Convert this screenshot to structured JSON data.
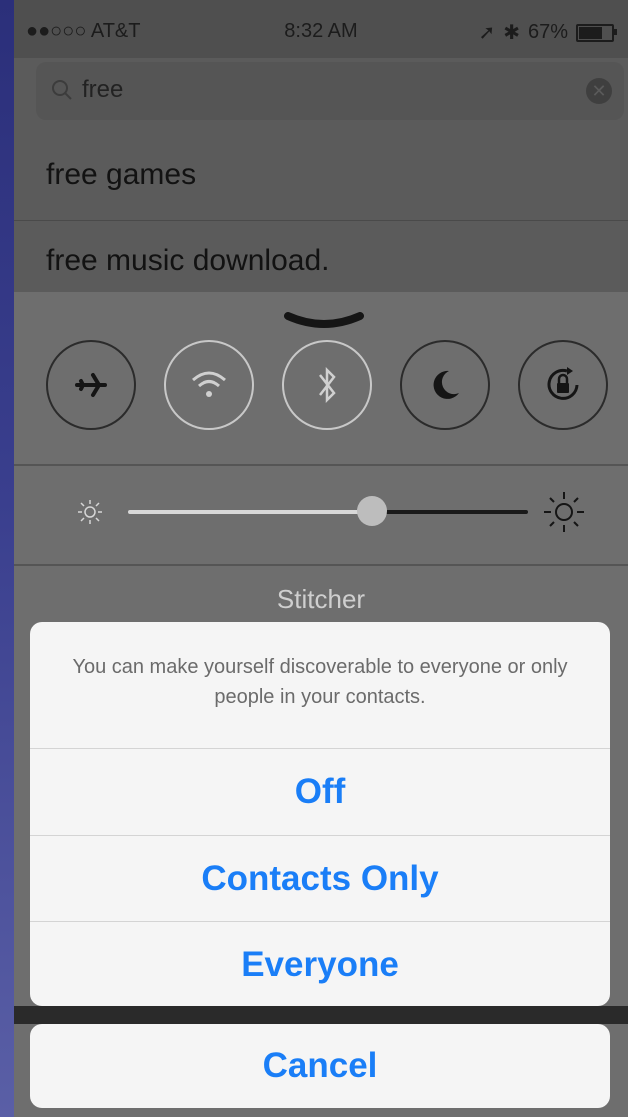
{
  "status_bar": {
    "carrier": "●●○○○ AT&T",
    "time": "8:32 AM",
    "battery": "67%",
    "battery_level": 0.67
  },
  "search": {
    "query": "free"
  },
  "suggestions": [
    "free games",
    "free music download."
  ],
  "control_center": {
    "toggles": [
      "airplane-mode",
      "wifi",
      "bluetooth",
      "do-not-disturb",
      "rotation-lock"
    ],
    "brightness": 0.61,
    "now_playing": "Stitcher"
  },
  "action_sheet": {
    "message": "You can make yourself discoverable to everyone or only people in your contacts.",
    "options": [
      "Off",
      "Contacts Only",
      "Everyone"
    ],
    "cancel": "Cancel",
    "accent_color": "#1a7ef7"
  }
}
